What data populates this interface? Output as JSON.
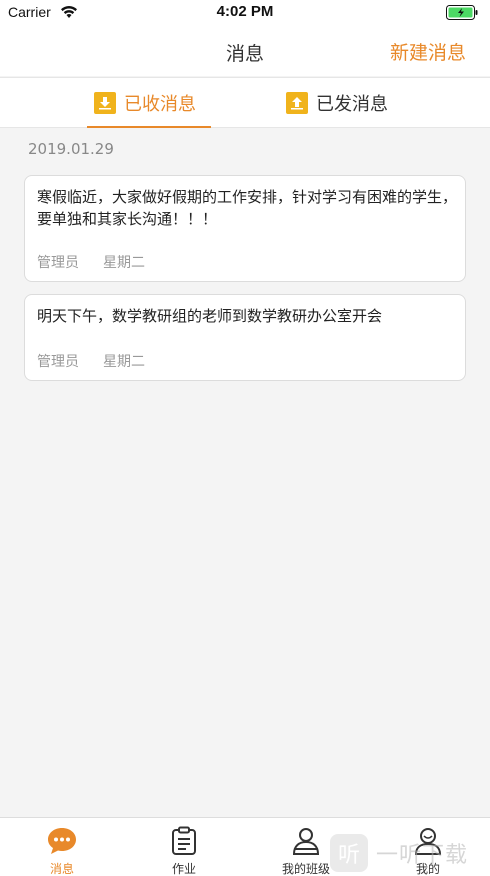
{
  "status_bar": {
    "carrier": "Carrier",
    "time": "4:02 PM"
  },
  "nav": {
    "title": "消息",
    "new_message": "新建消息"
  },
  "tabs": [
    {
      "label": "已收消息",
      "active": true
    },
    {
      "label": "已发消息",
      "active": false
    }
  ],
  "date": "2019.01.29",
  "messages": [
    {
      "text": "寒假临近，大家做好假期的工作安排，针对学习有困难的学生，要单独和其家长沟通！！！",
      "sender": "管理员",
      "day": "星期二"
    },
    {
      "text": "明天下午，数学教研组的老师到数学教研办公室开会",
      "sender": "管理员",
      "day": "星期二"
    }
  ],
  "tab_bar": [
    {
      "label": "消息",
      "icon": "chat-bubble-icon",
      "active": true
    },
    {
      "label": "作业",
      "icon": "clipboard-icon",
      "active": false
    },
    {
      "label": "我的班级",
      "icon": "class-person-icon",
      "active": false
    },
    {
      "label": "我的",
      "icon": "profile-person-icon",
      "active": false
    }
  ],
  "watermark": {
    "logo": "听",
    "text": "一听下载"
  },
  "colors": {
    "accent": "#e8892a",
    "tab_icon": "#f0b31c",
    "background": "#f4f4f4",
    "battery": "#4cd964"
  }
}
